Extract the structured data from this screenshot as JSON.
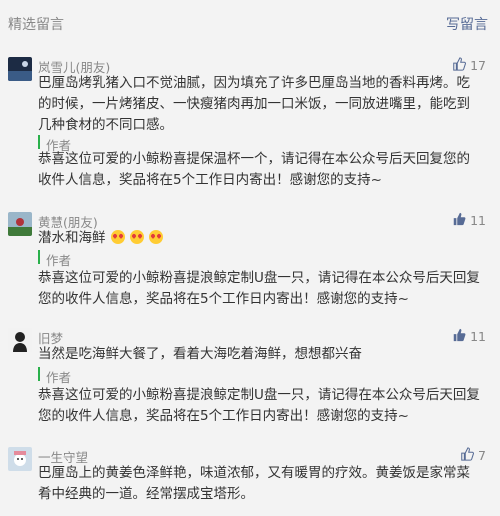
{
  "header": {
    "title": "精选留言",
    "write_label": "写留言"
  },
  "comments": [
    {
      "nick": "岚雪儿(朋友)",
      "likes": "17",
      "text_lines": [
        "巴厘岛烤乳猪入口不觉油腻，因为填充了许多巴厘岛当地的香料再烤。吃",
        "的时候，一片烤猪皮、一快瘦猪肉再加一口米饭，一同放进嘴里，能吃到",
        "几种食材的不同口感。"
      ],
      "reply_author": "作者",
      "reply_lines": [
        "恭喜这位可爱的小鲸粉喜提保温杯一个，请记得在本公众号后天回复您的",
        "收件人信息，奖品将在5个工作日内寄出！感谢您的支持~"
      ]
    },
    {
      "nick": "黄慧(朋友)",
      "likes": "11",
      "text_lines": [
        "潜水和海鲜"
      ],
      "emoji_count": 3,
      "reply_author": "作者",
      "reply_lines": [
        "恭喜这位可爱的小鲸粉喜提浪鲸定制U盘一只，请记得在本公众号后天回复",
        "您的收件人信息，奖品将在5个工作日内寄出！感谢您的支持~"
      ]
    },
    {
      "nick": "旧梦",
      "likes": "11",
      "text_lines": [
        "当然是吃海鲜大餐了，看着大海吃着海鲜，想想都兴奋"
      ],
      "reply_author": "作者",
      "reply_lines": [
        "恭喜这位可爱的小鲸粉喜提浪鲸定制U盘一只，请记得在本公众号后天回复",
        "您的收件人信息，奖品将在5个工作日内寄出！感谢您的支持~"
      ]
    },
    {
      "nick": "一生守望",
      "likes": "7",
      "text_lines": [
        "巴厘岛上的黄姜色泽鲜艳，味道浓郁，又有暖胃的疗效。黄姜饭是家常菜",
        "肴中经典的一道。经常摆成宝塔形。"
      ]
    }
  ],
  "colors": {
    "accent_link": "#576b95",
    "author_bar": "#2ab04b",
    "like_icon": "#576b95"
  },
  "icons": {
    "like": "thumbs-up-icon"
  }
}
